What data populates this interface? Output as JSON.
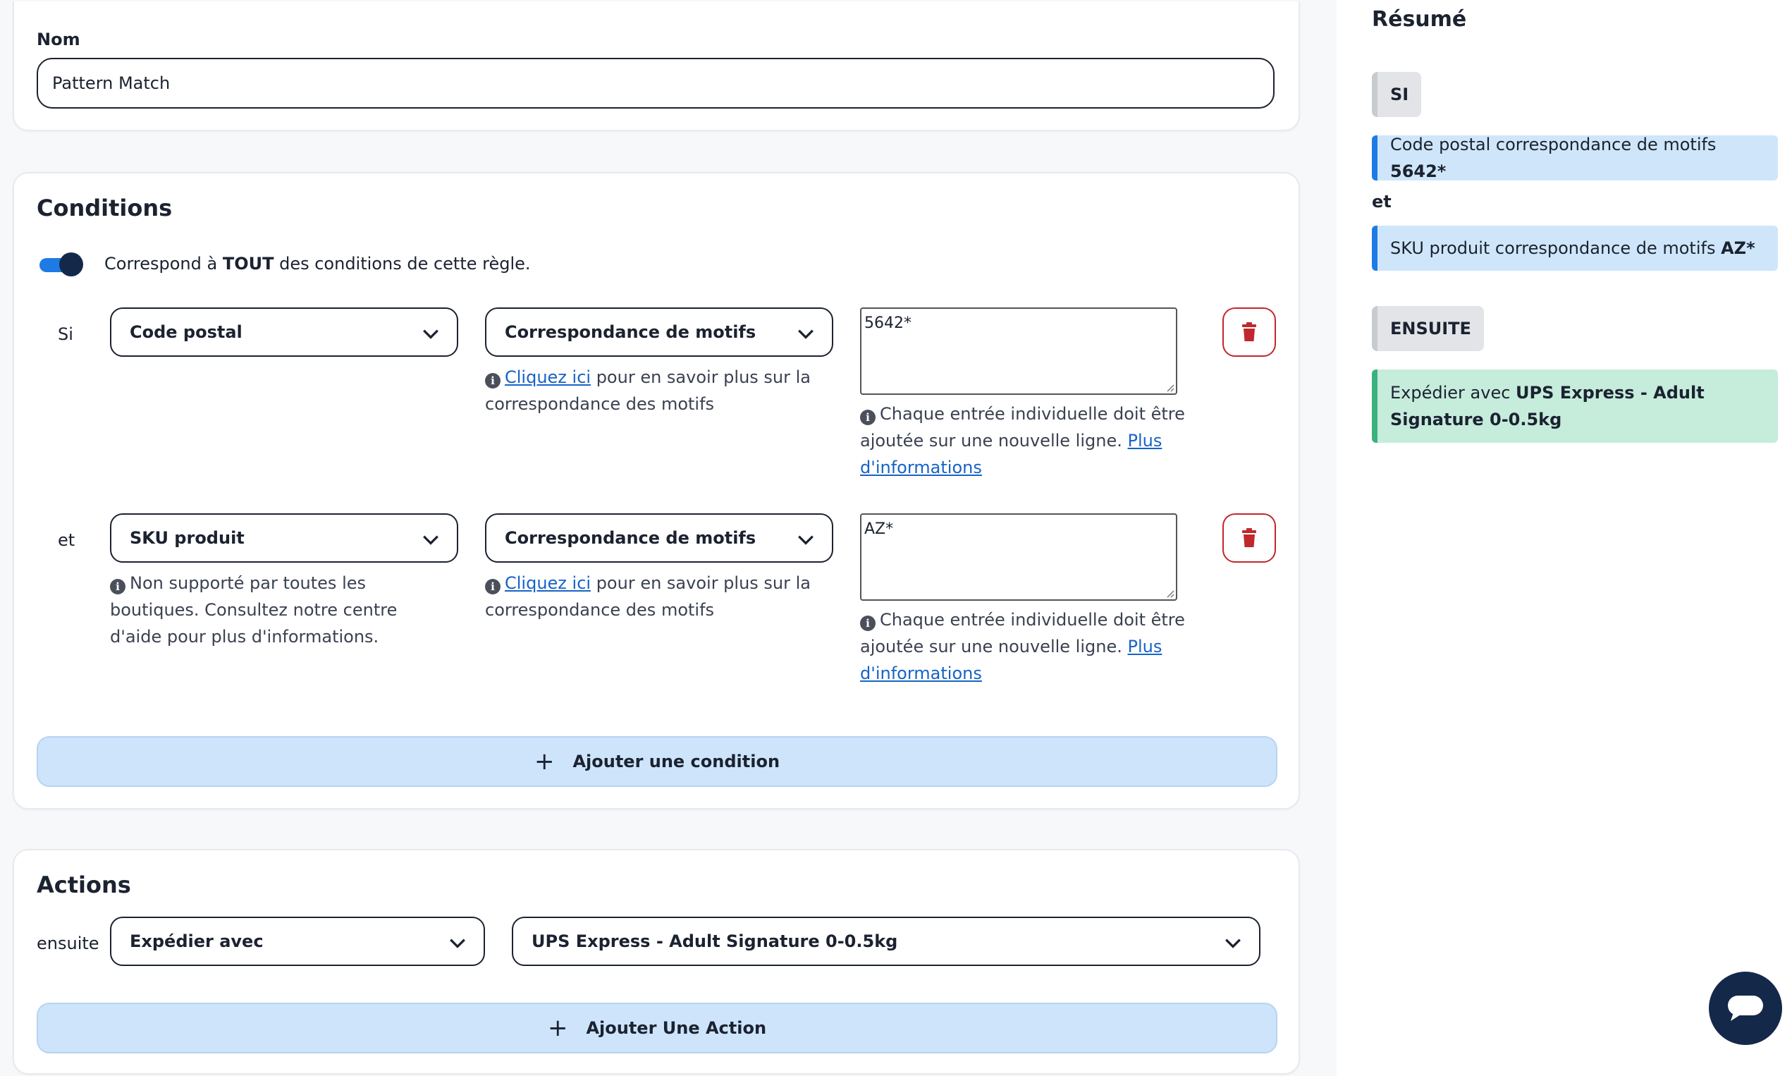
{
  "nom": {
    "label": "Nom",
    "value": "Pattern Match"
  },
  "conditions": {
    "title": "Conditions",
    "match_prefix": "Correspond à ",
    "match_bold": "TOUT",
    "match_suffix": " des conditions de cette règle.",
    "rows": [
      {
        "label": "Si",
        "field": "Code postal",
        "operator": "Correspondance de motifs",
        "value": "5642*",
        "operator_help_link": "Cliquez ici",
        "operator_help_text": " pour en savoir plus sur la correspondance des motifs",
        "value_help_text": "Chaque entrée individuelle doit être ajoutée sur une nouvelle ligne. ",
        "value_help_link": "Plus d'informations"
      },
      {
        "label": "et",
        "field": "SKU produit",
        "field_help": "Non supporté par toutes les boutiques. Consultez notre centre d'aide pour plus d'informations.",
        "operator": "Correspondance de motifs",
        "value": "AZ*",
        "operator_help_link": "Cliquez ici",
        "operator_help_text": " pour en savoir plus sur la correspondance des motifs",
        "value_help_text": "Chaque entrée individuelle doit être ajoutée sur une nouvelle ligne. ",
        "value_help_link": "Plus d'informations"
      }
    ],
    "add_label": "Ajouter une condition"
  },
  "actions": {
    "title": "Actions",
    "row_label": "ensuite",
    "action": "Expédier avec",
    "service": "UPS Express - Adult Signature 0-0.5kg",
    "add_label": "Ajouter Une Action"
  },
  "summary": {
    "title": "Résumé",
    "if_badge": "SI",
    "cond1_prefix": "Code postal correspondance de motifs ",
    "cond1_value": "5642*",
    "and_label": "et",
    "cond2_prefix": "SKU produit correspondance de motifs ",
    "cond2_value": "AZ*",
    "then_badge": "ENSUITE",
    "action_prefix": "Expédier avec ",
    "action_value": "UPS Express - Adult Signature 0-0.5kg"
  },
  "icons": {
    "chevron": "chevron-down-icon",
    "trash": "trash-icon",
    "info": "info-icon",
    "plus": "plus-icon",
    "chat": "chat-icon"
  },
  "colors": {
    "accent": "#1e7be6",
    "danger": "#c0282d",
    "success": "#3bb27e",
    "navy": "#14284a"
  }
}
